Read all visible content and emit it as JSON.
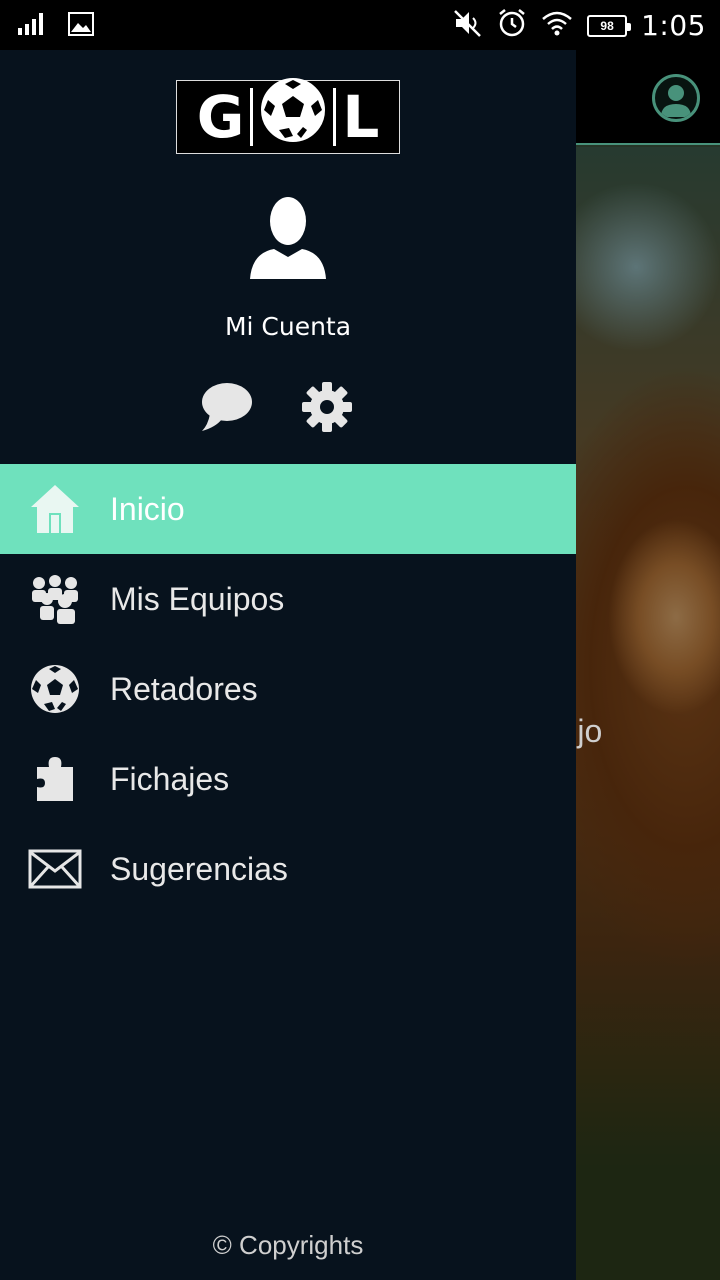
{
  "status_bar": {
    "time": "1:05",
    "battery": "98",
    "icons": [
      "signal-icon",
      "image-notification-icon",
      "mute-icon",
      "alarm-icon",
      "wifi-icon",
      "battery-icon"
    ]
  },
  "drawer": {
    "logo_letters": [
      "G",
      "L"
    ],
    "account_name": "Mi Cuenta",
    "menu": [
      {
        "label": "Inicio",
        "icon": "home-icon",
        "active": true
      },
      {
        "label": "Mis Equipos",
        "icon": "group-icon",
        "active": false
      },
      {
        "label": "Retadores",
        "icon": "soccer-ball-icon",
        "active": false
      },
      {
        "label": "Fichajes",
        "icon": "puzzle-icon",
        "active": false
      },
      {
        "label": "Sugerencias",
        "icon": "mail-icon",
        "active": false
      }
    ],
    "footer": "© Copyrights"
  },
  "background": {
    "partial_text": "mplejo"
  },
  "colors": {
    "drawer_bg": "#07121d",
    "accent": "#6fe1bd",
    "status_bar_bg": "#000000"
  }
}
